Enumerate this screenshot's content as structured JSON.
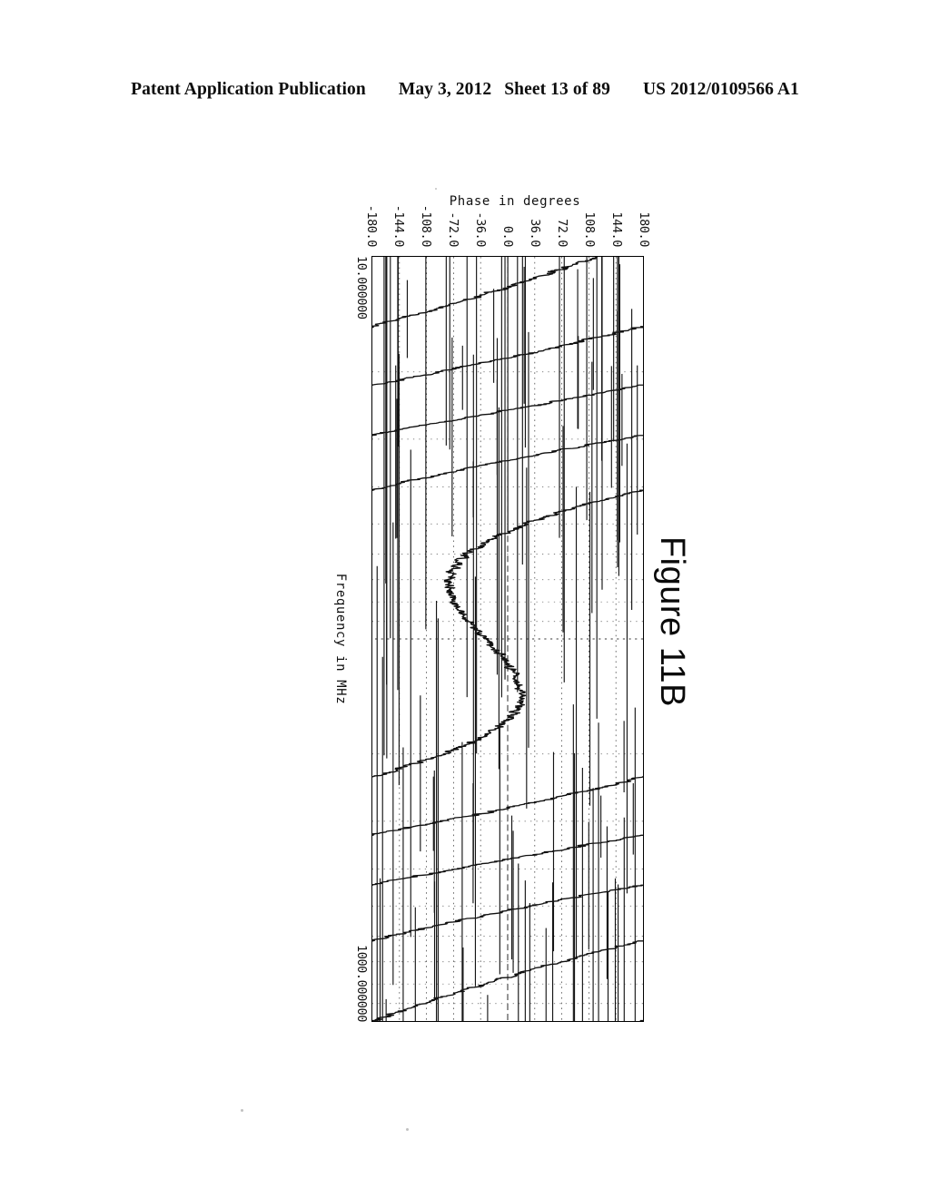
{
  "header": {
    "publication": "Patent Application Publication",
    "date": "May 3, 2012",
    "sheet": "Sheet 13 of 89",
    "number": "US 2012/0109566 A1"
  },
  "figure": {
    "caption": "Figure 11B"
  },
  "chart_data": {
    "type": "line",
    "title": "",
    "orientation": "rotated-90-clockwise",
    "xlabel": "Frequency in MHz",
    "ylabel": "Phase in degrees",
    "xscale": "log",
    "xlim": [
      10.0,
      1000.0
    ],
    "ylim": [
      -180.0,
      180.0
    ],
    "xtick_labels": [
      "10.000000",
      "1000.000000"
    ],
    "xtick_values": [
      10.0,
      1000.0
    ],
    "ytick_labels": [
      "180.0",
      "144.0",
      "108.0",
      "72.0",
      "36.0",
      "0.0",
      "-36.0",
      "-72.0",
      "-108.0",
      "-144.0",
      "-180.0"
    ],
    "ytick_values": [
      180,
      144,
      108,
      72,
      36,
      0,
      -36,
      -72,
      -108,
      -144,
      -180
    ],
    "grid": true,
    "grid_style": "dotted",
    "legend": null,
    "line_color": "#101010",
    "series": [
      {
        "name": "phase",
        "description": "Wrapped phase response sweeping from +180 to -180 with repeated 360-degree wraps across the 10 MHz to 1000 MHz log frequency span; noisy stair-stepped descent between wraps.",
        "wrap_count": 8,
        "x": [
          10.0,
          11.0,
          12.2,
          13.5,
          15.0,
          16.6,
          18.3,
          20.2,
          22.3,
          24.6,
          27.2,
          30.0,
          33.1,
          36.6,
          40.4,
          44.6,
          49.2,
          54.3,
          60.0,
          66.2,
          73.1,
          80.7,
          89.1,
          98.4,
          108.6,
          119.9,
          132.4,
          146.2,
          161.4,
          178.2,
          196.7,
          217.2,
          239.8,
          264.8,
          292.4,
          322.8,
          356.4,
          393.5,
          434.4,
          479.6,
          529.5,
          584.6,
          645.4,
          712.6,
          786.8,
          868.5,
          958.9,
          1000.0
        ],
        "y": [
          108,
          96,
          112,
          104,
          120,
          134,
          156,
          172,
          -175,
          -150,
          -120,
          -85,
          -40,
          10,
          60,
          110,
          160,
          -170,
          -130,
          -90,
          -45,
          5,
          55,
          105,
          155,
          -165,
          -120,
          -70,
          -20,
          30,
          80,
          130,
          175,
          -145,
          -95,
          -45,
          5,
          55,
          105,
          150,
          -165,
          -115,
          -65,
          -15,
          35,
          85,
          135,
          170
        ]
      }
    ]
  }
}
